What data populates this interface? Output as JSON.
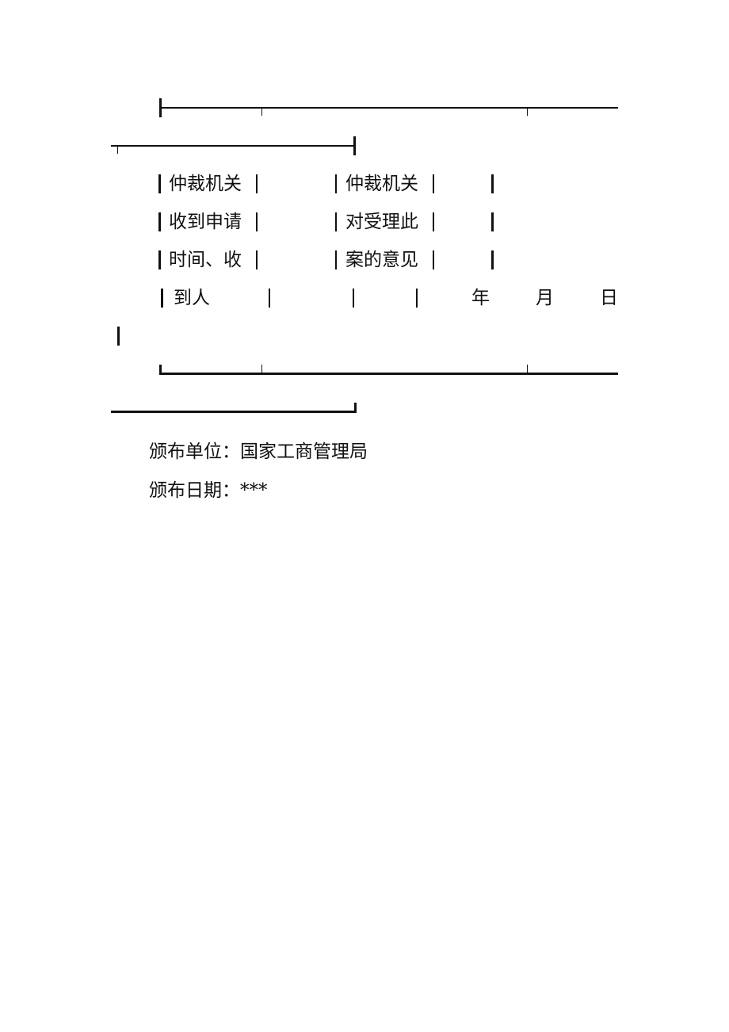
{
  "form_table": {
    "rows": [
      {
        "left": "仲裁机关",
        "middle": "仲裁机关"
      },
      {
        "left": "收到申请",
        "middle": "对受理此"
      },
      {
        "left": "时间、收",
        "middle": "案的意见"
      },
      {
        "left": "到人",
        "middle": ""
      }
    ],
    "date_labels": {
      "year": "年",
      "month": "月",
      "day": "日"
    }
  },
  "footer": {
    "publisher_label": "颁布单位：",
    "publisher_value": "国家工商管理局",
    "date_label": "颁布日期：",
    "date_value": "***"
  }
}
